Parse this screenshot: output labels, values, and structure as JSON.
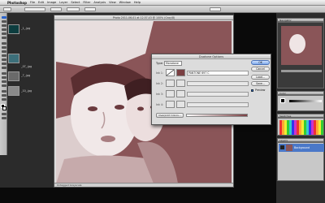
{
  "menubar": {
    "app": "Photoshop",
    "menus": [
      "File",
      "Edit",
      "Image",
      "Layer",
      "Select",
      "Filter",
      "Analysis",
      "View",
      "Window",
      "Help"
    ]
  },
  "document": {
    "title": "Photo 2011-06-01 at 12.57.43 @ 100% (Gray/8)",
    "status": "Untagged Grayscale"
  },
  "dialog": {
    "title": "Duotone Options",
    "type_label": "Type:",
    "type_value": "Monotone",
    "inks": [
      {
        "label": "Ink 1:",
        "name": "PANTONE 697 C",
        "color": "#7a3f42"
      },
      {
        "label": "Ink 2:",
        "name": ""
      },
      {
        "label": "Ink 3:",
        "name": ""
      },
      {
        "label": "Ink 4:",
        "name": ""
      }
    ],
    "overprint_label": "Overprint Colors...",
    "buttons": [
      "OK",
      "Cancel",
      "Load...",
      "Save..."
    ],
    "preview_label": "Preview",
    "preview_checked": true
  },
  "left_files": [
    {
      "name": "_1_.jpg"
    },
    {
      "name": "_07_.jpg"
    },
    {
      "name": "_7_.jpg"
    },
    {
      "name": "_10_.jpg"
    }
  ],
  "panels": {
    "navigator": "Navigator",
    "color": "Color",
    "swatches": "Swatches",
    "layers": "Layers",
    "layer_name": "Background"
  },
  "colors": {
    "duotone": "#8a5558",
    "duotone_light": "#e9dcdc"
  }
}
